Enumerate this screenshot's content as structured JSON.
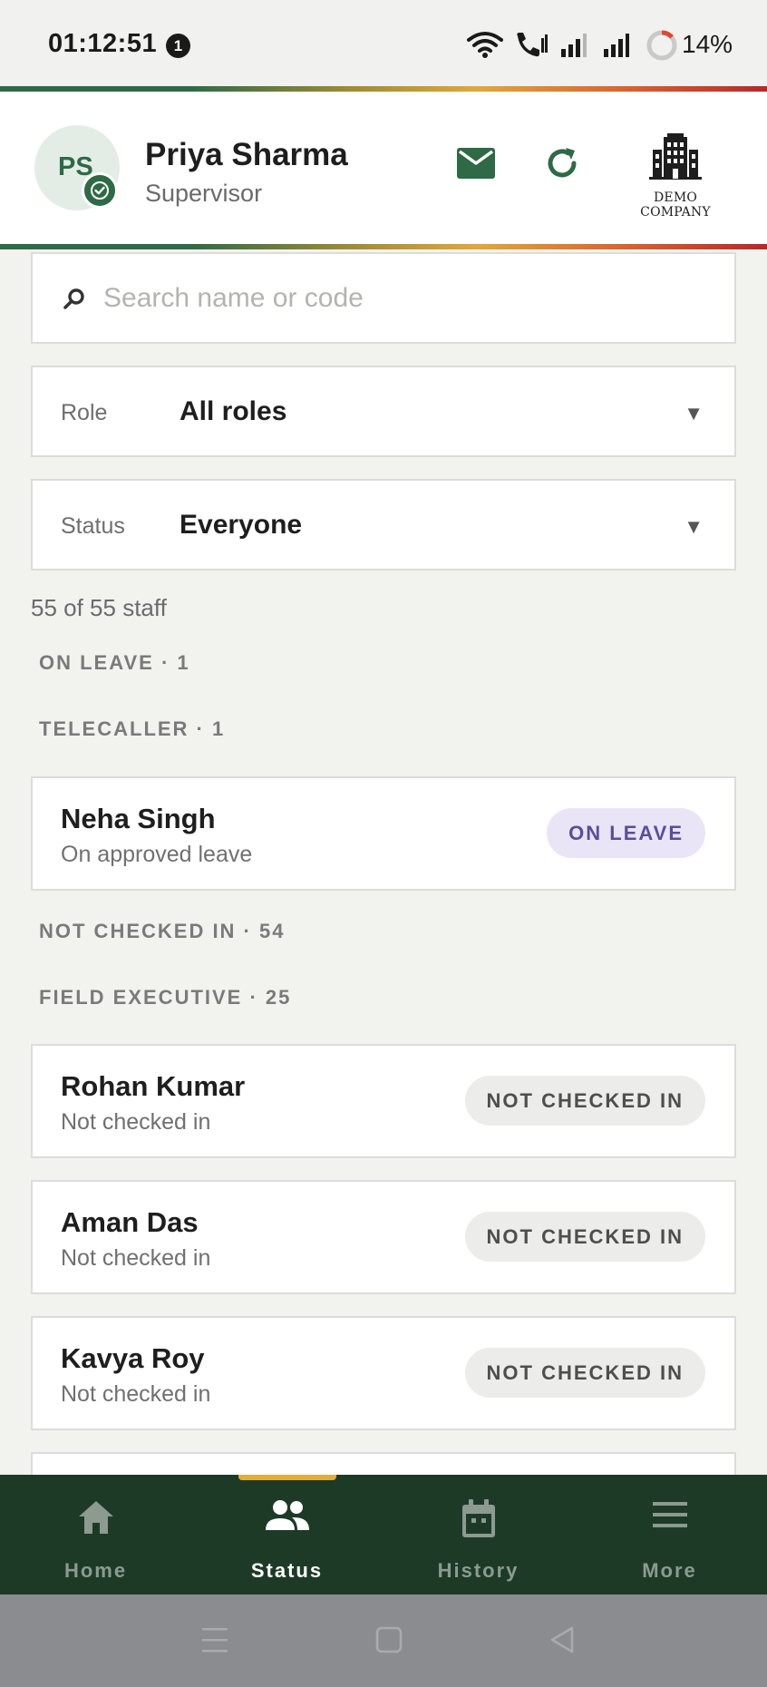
{
  "status_bar": {
    "time": "01:12:51",
    "notification_count": "1",
    "battery_percent": "14%"
  },
  "header": {
    "avatar_initials": "PS",
    "user_name": "Priya Sharma",
    "user_role": "Supervisor",
    "company_name": "DEMO COMPANY",
    "icons": [
      "mail-icon",
      "refresh-icon",
      "building-icon"
    ]
  },
  "filters": {
    "search_placeholder": "Search name or code",
    "search_value": "",
    "role": {
      "label": "Role",
      "value": "All roles"
    },
    "status": {
      "label": "Status",
      "value": "Everyone"
    }
  },
  "staff_count_text": "55 of 55 staff",
  "sections": [
    {
      "heading": "ON LEAVE · 1",
      "subgroups": [
        {
          "heading": "TELECALLER · 1",
          "staff": [
            {
              "name": "Neha Singh",
              "subtitle": "On approved leave",
              "badge": "ON LEAVE"
            }
          ]
        }
      ]
    },
    {
      "heading": "NOT CHECKED IN · 54",
      "subgroups": [
        {
          "heading": "FIELD EXECUTIVE · 25",
          "staff": [
            {
              "name": "Rohan Kumar",
              "subtitle": "Not checked in",
              "badge": "NOT CHECKED IN"
            },
            {
              "name": "Aman Das",
              "subtitle": "Not checked in",
              "badge": "NOT CHECKED IN"
            },
            {
              "name": "Kavya Roy",
              "subtitle": "Not checked in",
              "badge": "NOT CHECKED IN"
            }
          ]
        }
      ]
    }
  ],
  "bottom_nav": {
    "active": "Status",
    "items": [
      {
        "label": "Home",
        "icon": "home-icon"
      },
      {
        "label": "Status",
        "icon": "people-icon"
      },
      {
        "label": "History",
        "icon": "calendar-icon"
      },
      {
        "label": "More",
        "icon": "menu-icon"
      }
    ]
  },
  "colors": {
    "brand_green": "#2d6a45",
    "nav_bg": "#1d3a27",
    "active_indicator": "#e0ad3c",
    "leave_badge_bg": "#e9e5f6",
    "leave_badge_text": "#5a4d9a"
  }
}
